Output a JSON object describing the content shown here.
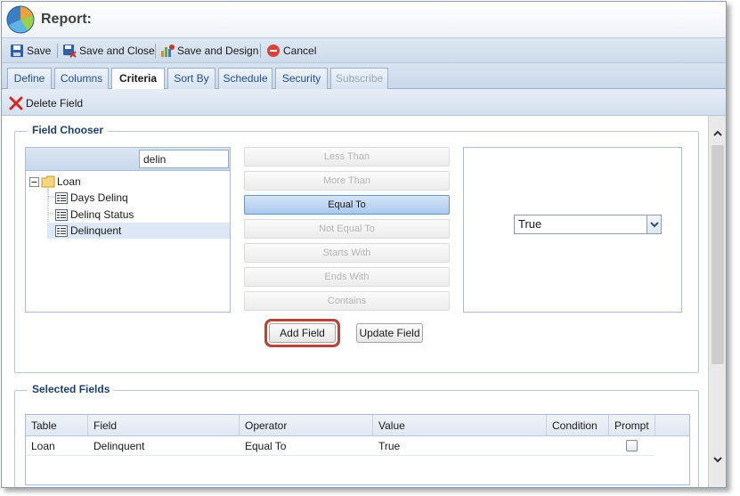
{
  "title": "Report:",
  "toolbar": {
    "save": "Save",
    "save_close": "Save and Close",
    "save_design": "Save and Design",
    "cancel": "Cancel"
  },
  "tabs": [
    {
      "label": "Define",
      "state": "normal"
    },
    {
      "label": "Columns",
      "state": "normal"
    },
    {
      "label": "Criteria",
      "state": "active"
    },
    {
      "label": "Sort By",
      "state": "normal"
    },
    {
      "label": "Schedule",
      "state": "normal"
    },
    {
      "label": "Security",
      "state": "normal"
    },
    {
      "label": "Subscribe",
      "state": "disabled"
    }
  ],
  "subtoolbar": {
    "delete_field": "Delete Field"
  },
  "field_chooser": {
    "legend": "Field Chooser",
    "search_value": "delin",
    "tree": {
      "root": "Loan",
      "children": [
        "Days Delinq",
        "Delinq Status",
        "Delinquent"
      ],
      "selected": "Delinquent"
    },
    "operators": [
      {
        "label": "Less Than",
        "enabled": false
      },
      {
        "label": "More Than",
        "enabled": false
      },
      {
        "label": "Equal To",
        "enabled": true,
        "selected": true
      },
      {
        "label": "Not Equal To",
        "enabled": false
      },
      {
        "label": "Starts With",
        "enabled": false
      },
      {
        "label": "Ends With",
        "enabled": false
      },
      {
        "label": "Contains",
        "enabled": false
      }
    ],
    "value_selected": "True",
    "add_field": "Add Field",
    "update_field": "Update Field"
  },
  "selected_fields": {
    "legend": "Selected Fields",
    "columns": [
      "Table",
      "Field",
      "Operator",
      "Value",
      "Condition",
      "Prompt"
    ],
    "rows": [
      {
        "table": "Loan",
        "field": "Delinquent",
        "operator": "Equal To",
        "value": "True",
        "condition": "",
        "prompt": false
      }
    ]
  },
  "colors": {
    "accent": "#1f4e8c",
    "highlight_border": "#b3463a",
    "selected_op": "#a9c8ec"
  }
}
